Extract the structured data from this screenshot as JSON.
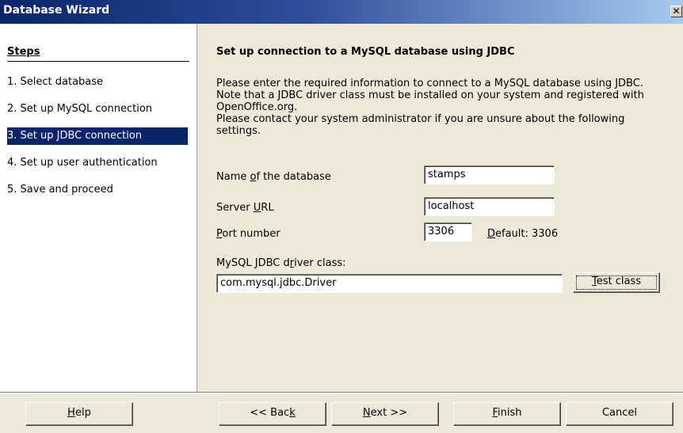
{
  "window": {
    "title": "Database Wizard",
    "close_glyph": "✕"
  },
  "steps": {
    "heading": "Steps",
    "items": [
      {
        "label": "1.  Select database"
      },
      {
        "label": "2.  Set up MySQL connection"
      },
      {
        "label": "3.  Set up JDBC connection"
      },
      {
        "label": "4.  Set up user authentication"
      },
      {
        "label": "5.  Save and proceed"
      }
    ],
    "active_index": 2
  },
  "main": {
    "title": "Set up connection to a MySQL database using JDBC",
    "description_lines": [
      "Please enter the required information to connect to a MySQL database using JDBC.",
      "Note that a JDBC driver class must be installed on your system and registered with",
      "OpenOffice.org.",
      "Please contact your system administrator if you are unsure about the following",
      "settings."
    ],
    "db_name": {
      "label_pre": "Name ",
      "label_mn": "o",
      "label_post": "f the database",
      "value": "stamps"
    },
    "server_url": {
      "label_pre": "Server ",
      "label_mn": "U",
      "label_post": "RL",
      "value": "localhost"
    },
    "port": {
      "label_pre": "",
      "label_mn": "P",
      "label_post": "ort number",
      "value": "3306",
      "default_pre": "",
      "default_mn": "D",
      "default_post": "efault: 3306"
    },
    "driver": {
      "label_pre": "MySQL JDBC d",
      "label_mn": "r",
      "label_post": "iver class:",
      "value": "com.mysql.jdbc.Driver"
    },
    "test_button": {
      "pre": "",
      "mn": "T",
      "post": "est class"
    }
  },
  "footer": {
    "help": {
      "pre": "",
      "mn": "H",
      "post": "elp"
    },
    "back": {
      "pre": "<< Bac",
      "mn": "k",
      "post": ""
    },
    "next": {
      "pre": "",
      "mn": "N",
      "post": "ext >>"
    },
    "finish": {
      "pre": "",
      "mn": "F",
      "post": "inish"
    },
    "cancel": {
      "pre": "Cancel",
      "mn": "",
      "post": ""
    }
  }
}
